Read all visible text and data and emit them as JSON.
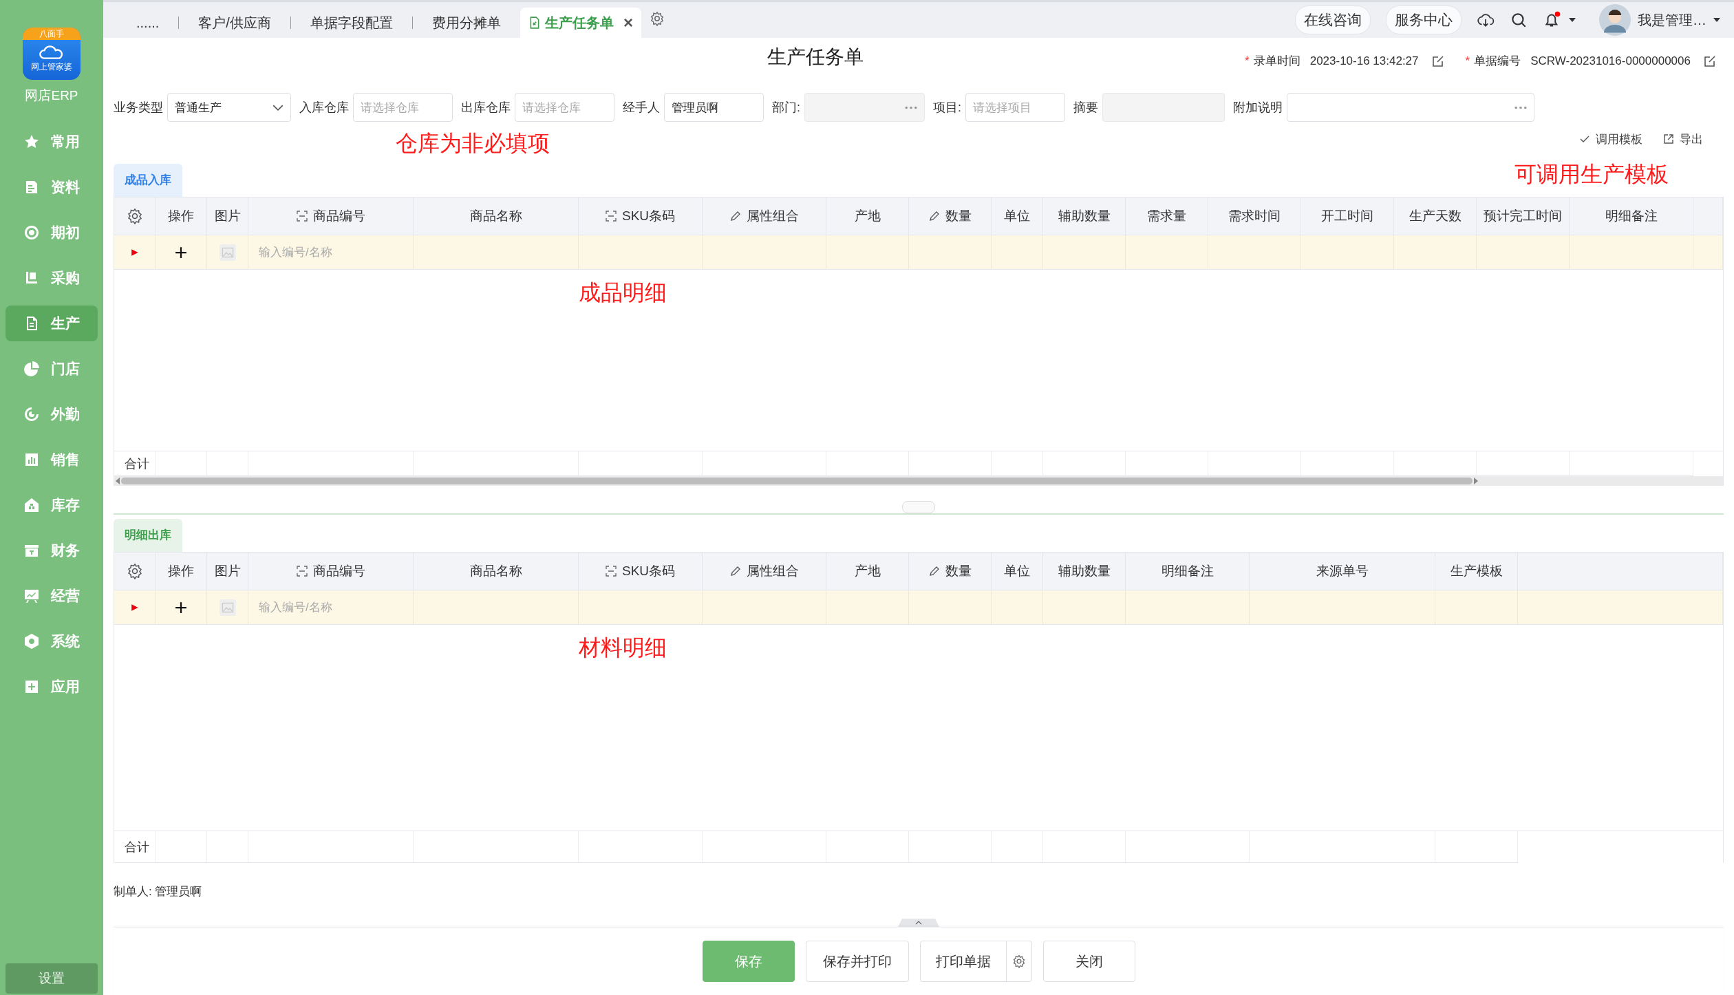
{
  "sidebar": {
    "logo": {
      "banner": "八面手",
      "caption": "网上管家婆"
    },
    "app_name": "网店ERP",
    "items": [
      {
        "label": "常用",
        "selected": false
      },
      {
        "label": "资料",
        "selected": false
      },
      {
        "label": "期初",
        "selected": false
      },
      {
        "label": "采购",
        "selected": false
      },
      {
        "label": "生产",
        "selected": true
      },
      {
        "label": "门店",
        "selected": false
      },
      {
        "label": "外勤",
        "selected": false
      },
      {
        "label": "销售",
        "selected": false
      },
      {
        "label": "库存",
        "selected": false
      },
      {
        "label": "财务",
        "selected": false
      },
      {
        "label": "经营",
        "selected": false
      },
      {
        "label": "系统",
        "selected": false
      },
      {
        "label": "应用",
        "selected": false
      }
    ],
    "settings": "设置"
  },
  "tabs": [
    {
      "label": "......",
      "selected": false
    },
    {
      "label": "客户/供应商",
      "selected": false
    },
    {
      "label": "单据字段配置",
      "selected": false
    },
    {
      "label": "费用分摊单",
      "selected": false
    },
    {
      "label": "生产任务单",
      "selected": true,
      "close": "×"
    }
  ],
  "header_actions": [
    {
      "label": "在线咨询"
    },
    {
      "label": "服务中心"
    }
  ],
  "notifications": {
    "unread": true
  },
  "user": {
    "name": "我是管理…"
  },
  "page_title": "生产任务单",
  "meta": [
    {
      "required_mark": "*",
      "label": "录单时间",
      "value": "2023-10-16 13:42:27"
    },
    {
      "required_mark": "*",
      "label": "单据编号",
      "value": "SCRW-20231016-0000000006"
    }
  ],
  "form": [
    {
      "label": "业务类型",
      "kind": "select",
      "value": "普通生产",
      "disabled": false
    },
    {
      "label": "入库仓库",
      "kind": "text",
      "placeholder": "请选择仓库",
      "disabled": false
    },
    {
      "label": "出库仓库",
      "kind": "text",
      "placeholder": "请选择仓库",
      "disabled": false
    },
    {
      "label": "经手人",
      "kind": "text",
      "value": "管理员啊",
      "disabled": false
    },
    {
      "label": "部门:",
      "kind": "picker",
      "disabled": true
    },
    {
      "label": "项目:",
      "kind": "text",
      "placeholder": "请选择项目",
      "disabled": false
    },
    {
      "label": "摘要",
      "kind": "text",
      "disabled": true
    },
    {
      "label": "附加说明",
      "kind": "picker",
      "disabled": false
    }
  ],
  "annotations": [
    {
      "text": "仓库为非必填项"
    },
    {
      "text": "可调用生产模板"
    }
  ],
  "toolbar": [
    {
      "kind": "check",
      "label": "调用模板"
    },
    {
      "kind": "export",
      "label": "导出"
    }
  ],
  "sections": [
    {
      "tab": "成品入库",
      "color": "#2f7fe8",
      "has_scrollbar": true,
      "note": "成品明细",
      "columns": [
        {
          "kind": "settings"
        },
        {
          "kind": "plain",
          "label": "操作"
        },
        {
          "kind": "plain",
          "label": "图片"
        },
        {
          "kind": "scan",
          "label": "商品编号"
        },
        {
          "kind": "plain",
          "label": "商品名称"
        },
        {
          "kind": "scan",
          "label": "SKU条码"
        },
        {
          "kind": "edit",
          "label": "属性组合"
        },
        {
          "kind": "plain",
          "label": "产地"
        },
        {
          "kind": "edit",
          "label": "数量"
        },
        {
          "kind": "plain",
          "label": "单位"
        },
        {
          "kind": "plain",
          "label": "辅助数量"
        },
        {
          "kind": "plain",
          "label": "需求量"
        },
        {
          "kind": "plain",
          "label": "需求时间"
        },
        {
          "kind": "plain",
          "label": "开工时间"
        },
        {
          "kind": "plain",
          "label": "生产天数"
        },
        {
          "kind": "plain",
          "label": "预计完工时间"
        },
        {
          "kind": "plain",
          "label": "明细备注"
        }
      ],
      "entry_placeholder": "输入编号/名称",
      "total_label": "合计"
    },
    {
      "tab": "明细出库",
      "color": "#3c9f4c",
      "has_scrollbar": false,
      "note": "材料明细",
      "columns": [
        {
          "kind": "settings"
        },
        {
          "kind": "plain",
          "label": "操作"
        },
        {
          "kind": "plain",
          "label": "图片"
        },
        {
          "kind": "scan",
          "label": "商品编号"
        },
        {
          "kind": "plain",
          "label": "商品名称"
        },
        {
          "kind": "scan",
          "label": "SKU条码"
        },
        {
          "kind": "edit",
          "label": "属性组合"
        },
        {
          "kind": "plain",
          "label": "产地"
        },
        {
          "kind": "edit",
          "label": "数量"
        },
        {
          "kind": "plain",
          "label": "单位"
        },
        {
          "kind": "plain",
          "label": "辅助数量"
        },
        {
          "kind": "plain",
          "label": "明细备注"
        },
        {
          "kind": "plain",
          "label": "来源单号"
        },
        {
          "kind": "plain",
          "label": "生产模板"
        }
      ],
      "entry_placeholder": "输入编号/名称",
      "total_label": "合计"
    }
  ],
  "creator": "制单人: 管理员啊",
  "buttons": [
    {
      "kind": "primary",
      "label": "保存"
    },
    {
      "kind": "default",
      "label": "保存并打印"
    },
    {
      "kind": "split",
      "label": "打印单据"
    },
    {
      "kind": "default",
      "label": "关闭"
    }
  ]
}
